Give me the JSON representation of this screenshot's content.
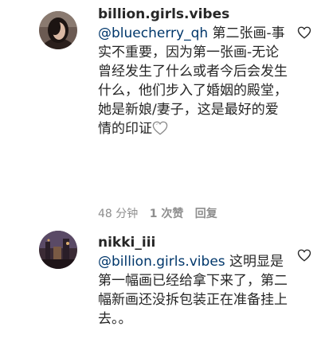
{
  "comments": [
    {
      "username": "billion.girls.vibes",
      "mention": "@bluecherry_qh",
      "text": " 第二张画-事实不重要，因为第一张画-无论曾经发生了什么或者今后会发生什么，他们步入了婚姻的殿堂，她是新娘/妻子，这是最好的爱情的印证",
      "time": "48 分钟",
      "likes": "1 次赞",
      "reply": "回复"
    },
    {
      "username": "nikki_iii",
      "mention": "@billion.girls.vibes",
      "text": " 这明显是第一幅画已经给拿下来了，第二幅新画还没拆包装正在准备挂上去。。"
    }
  ],
  "icons": {
    "like": "heart-outline-icon",
    "emoji": "white-heart-emoji"
  },
  "colors": {
    "mention": "#00376b",
    "meta": "#8e8e8e",
    "text": "#262626"
  }
}
